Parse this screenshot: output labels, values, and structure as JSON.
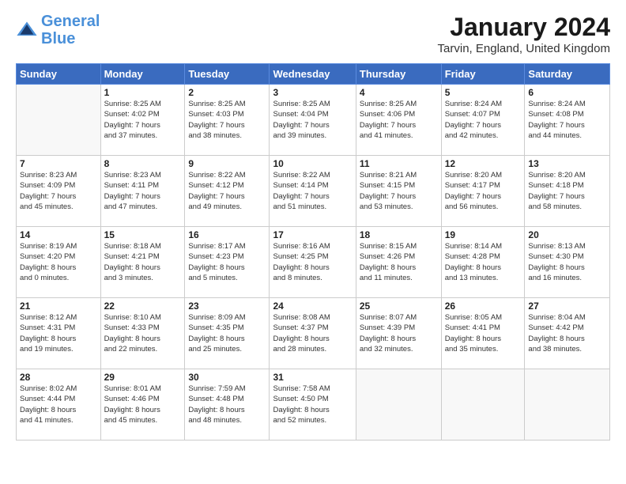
{
  "logo": {
    "text_general": "General",
    "text_blue": "Blue"
  },
  "header": {
    "month_title": "January 2024",
    "location": "Tarvin, England, United Kingdom"
  },
  "days_of_week": [
    "Sunday",
    "Monday",
    "Tuesday",
    "Wednesday",
    "Thursday",
    "Friday",
    "Saturday"
  ],
  "weeks": [
    [
      {
        "day": "",
        "info": ""
      },
      {
        "day": "1",
        "info": "Sunrise: 8:25 AM\nSunset: 4:02 PM\nDaylight: 7 hours\nand 37 minutes."
      },
      {
        "day": "2",
        "info": "Sunrise: 8:25 AM\nSunset: 4:03 PM\nDaylight: 7 hours\nand 38 minutes."
      },
      {
        "day": "3",
        "info": "Sunrise: 8:25 AM\nSunset: 4:04 PM\nDaylight: 7 hours\nand 39 minutes."
      },
      {
        "day": "4",
        "info": "Sunrise: 8:25 AM\nSunset: 4:06 PM\nDaylight: 7 hours\nand 41 minutes."
      },
      {
        "day": "5",
        "info": "Sunrise: 8:24 AM\nSunset: 4:07 PM\nDaylight: 7 hours\nand 42 minutes."
      },
      {
        "day": "6",
        "info": "Sunrise: 8:24 AM\nSunset: 4:08 PM\nDaylight: 7 hours\nand 44 minutes."
      }
    ],
    [
      {
        "day": "7",
        "info": "Sunrise: 8:23 AM\nSunset: 4:09 PM\nDaylight: 7 hours\nand 45 minutes."
      },
      {
        "day": "8",
        "info": "Sunrise: 8:23 AM\nSunset: 4:11 PM\nDaylight: 7 hours\nand 47 minutes."
      },
      {
        "day": "9",
        "info": "Sunrise: 8:22 AM\nSunset: 4:12 PM\nDaylight: 7 hours\nand 49 minutes."
      },
      {
        "day": "10",
        "info": "Sunrise: 8:22 AM\nSunset: 4:14 PM\nDaylight: 7 hours\nand 51 minutes."
      },
      {
        "day": "11",
        "info": "Sunrise: 8:21 AM\nSunset: 4:15 PM\nDaylight: 7 hours\nand 53 minutes."
      },
      {
        "day": "12",
        "info": "Sunrise: 8:20 AM\nSunset: 4:17 PM\nDaylight: 7 hours\nand 56 minutes."
      },
      {
        "day": "13",
        "info": "Sunrise: 8:20 AM\nSunset: 4:18 PM\nDaylight: 7 hours\nand 58 minutes."
      }
    ],
    [
      {
        "day": "14",
        "info": "Sunrise: 8:19 AM\nSunset: 4:20 PM\nDaylight: 8 hours\nand 0 minutes."
      },
      {
        "day": "15",
        "info": "Sunrise: 8:18 AM\nSunset: 4:21 PM\nDaylight: 8 hours\nand 3 minutes."
      },
      {
        "day": "16",
        "info": "Sunrise: 8:17 AM\nSunset: 4:23 PM\nDaylight: 8 hours\nand 5 minutes."
      },
      {
        "day": "17",
        "info": "Sunrise: 8:16 AM\nSunset: 4:25 PM\nDaylight: 8 hours\nand 8 minutes."
      },
      {
        "day": "18",
        "info": "Sunrise: 8:15 AM\nSunset: 4:26 PM\nDaylight: 8 hours\nand 11 minutes."
      },
      {
        "day": "19",
        "info": "Sunrise: 8:14 AM\nSunset: 4:28 PM\nDaylight: 8 hours\nand 13 minutes."
      },
      {
        "day": "20",
        "info": "Sunrise: 8:13 AM\nSunset: 4:30 PM\nDaylight: 8 hours\nand 16 minutes."
      }
    ],
    [
      {
        "day": "21",
        "info": "Sunrise: 8:12 AM\nSunset: 4:31 PM\nDaylight: 8 hours\nand 19 minutes."
      },
      {
        "day": "22",
        "info": "Sunrise: 8:10 AM\nSunset: 4:33 PM\nDaylight: 8 hours\nand 22 minutes."
      },
      {
        "day": "23",
        "info": "Sunrise: 8:09 AM\nSunset: 4:35 PM\nDaylight: 8 hours\nand 25 minutes."
      },
      {
        "day": "24",
        "info": "Sunrise: 8:08 AM\nSunset: 4:37 PM\nDaylight: 8 hours\nand 28 minutes."
      },
      {
        "day": "25",
        "info": "Sunrise: 8:07 AM\nSunset: 4:39 PM\nDaylight: 8 hours\nand 32 minutes."
      },
      {
        "day": "26",
        "info": "Sunrise: 8:05 AM\nSunset: 4:41 PM\nDaylight: 8 hours\nand 35 minutes."
      },
      {
        "day": "27",
        "info": "Sunrise: 8:04 AM\nSunset: 4:42 PM\nDaylight: 8 hours\nand 38 minutes."
      }
    ],
    [
      {
        "day": "28",
        "info": "Sunrise: 8:02 AM\nSunset: 4:44 PM\nDaylight: 8 hours\nand 41 minutes."
      },
      {
        "day": "29",
        "info": "Sunrise: 8:01 AM\nSunset: 4:46 PM\nDaylight: 8 hours\nand 45 minutes."
      },
      {
        "day": "30",
        "info": "Sunrise: 7:59 AM\nSunset: 4:48 PM\nDaylight: 8 hours\nand 48 minutes."
      },
      {
        "day": "31",
        "info": "Sunrise: 7:58 AM\nSunset: 4:50 PM\nDaylight: 8 hours\nand 52 minutes."
      },
      {
        "day": "",
        "info": ""
      },
      {
        "day": "",
        "info": ""
      },
      {
        "day": "",
        "info": ""
      }
    ]
  ]
}
